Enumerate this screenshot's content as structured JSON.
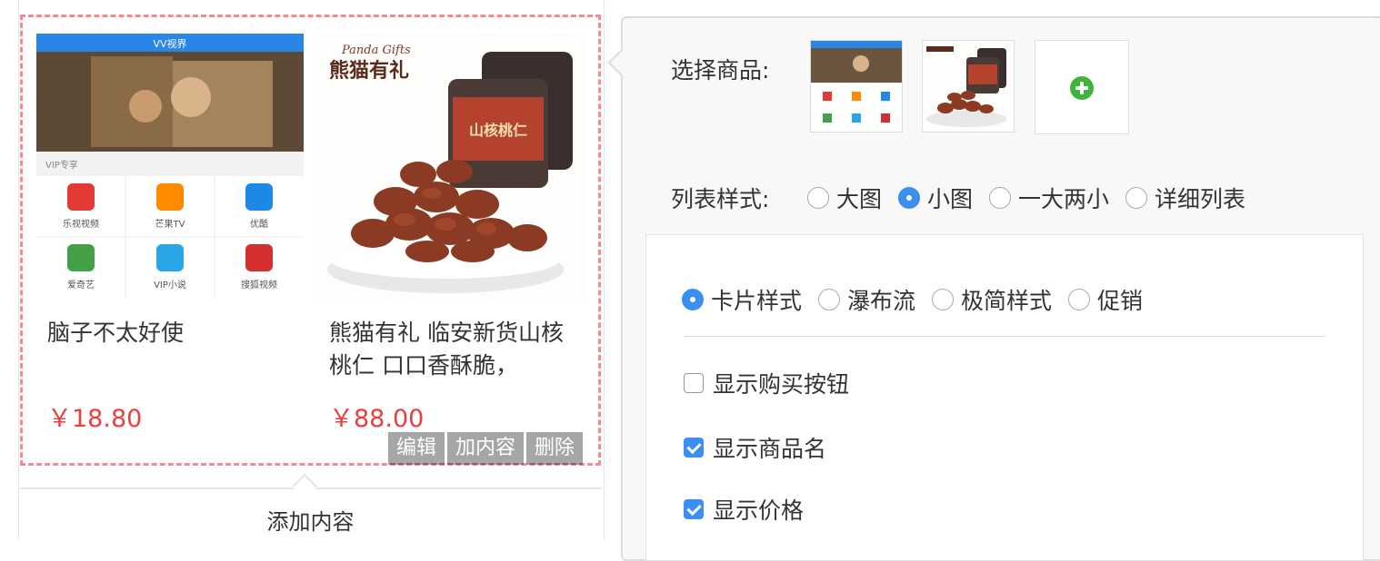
{
  "products": [
    {
      "title": "脑子不太好使",
      "price": "￥18.80",
      "image": {
        "header_title": "VV视界",
        "section_label": "VIP专享",
        "apps": [
          {
            "label": "乐视视频",
            "color": "#e53935"
          },
          {
            "label": "芒果TV",
            "color": "#ff8a00"
          },
          {
            "label": "优酷",
            "color": "#1e88e5"
          },
          {
            "label": "爱奇艺",
            "color": "#43a047"
          },
          {
            "label": "VIP小说",
            "color": "#29a5e8"
          },
          {
            "label": "搜狐视频",
            "color": "#d32f2f"
          }
        ]
      }
    },
    {
      "title": "熊猫有礼 临安新货山核桃仁 口口香酥脆，",
      "price": "￥88.00",
      "image": {
        "brand_en": "Panda Gifts",
        "brand_cn": "熊猫有礼",
        "jar_label": "山核桃仁"
      }
    }
  ],
  "actions": {
    "edit": "编辑",
    "add": "加内容",
    "delete": "删除"
  },
  "add_content_label": "添加内容",
  "editor": {
    "select_label": "选择商品:",
    "list_style_label": "列表样式:",
    "list_styles": [
      {
        "label": "大图",
        "selected": false
      },
      {
        "label": "小图",
        "selected": true
      },
      {
        "label": "一大两小",
        "selected": false
      },
      {
        "label": "详细列表",
        "selected": false
      }
    ],
    "card_styles": [
      {
        "label": "卡片样式",
        "selected": true
      },
      {
        "label": "瀑布流",
        "selected": false
      },
      {
        "label": "极简样式",
        "selected": false
      },
      {
        "label": "促销",
        "selected": false
      }
    ],
    "options": [
      {
        "label": "显示购买按钮",
        "checked": false
      },
      {
        "label": "显示商品名",
        "checked": true
      },
      {
        "label": "显示价格",
        "checked": true
      }
    ]
  },
  "colors": {
    "accent": "#3b8ff0",
    "price": "#e8403f",
    "dashed_border": "#ef8b95",
    "add_icon": "#3fb43a"
  }
}
